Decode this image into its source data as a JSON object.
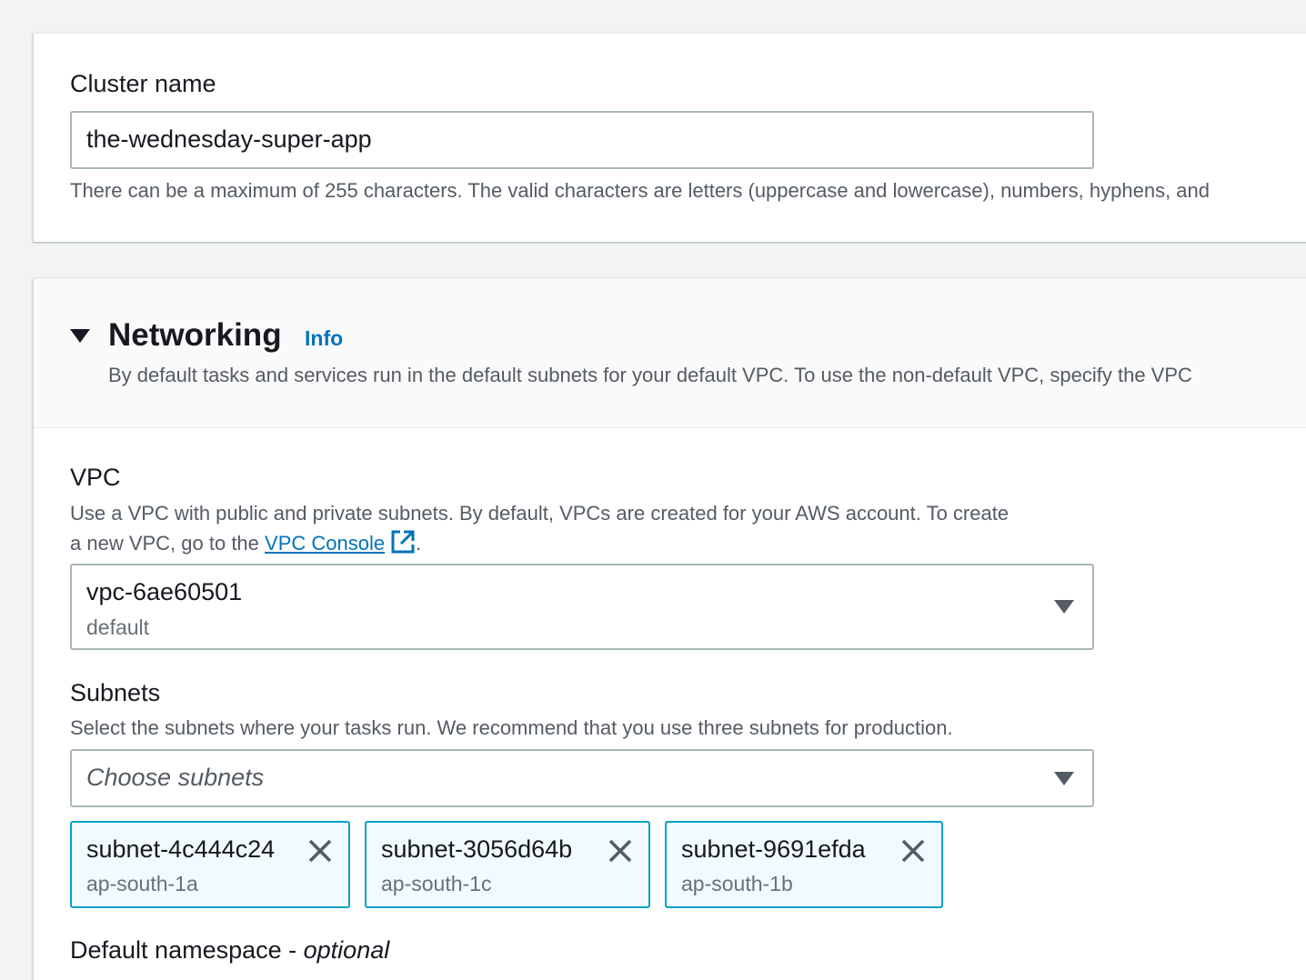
{
  "cluster": {
    "label": "Cluster name",
    "value": "the-wednesday-super-app",
    "hint": "There can be a maximum of 255 characters. The valid characters are letters (uppercase and lowercase), numbers, hyphens, and"
  },
  "networking": {
    "title": "Networking",
    "info_label": "Info",
    "description": "By default tasks and services run in the default subnets for your default VPC. To use the non-default VPC, specify the VPC",
    "vpc": {
      "label": "VPC",
      "desc_line1": "Use a VPC with public and private subnets. By default, VPCs are created for your AWS account. To create",
      "desc_line2_prefix": "a new VPC, go to the ",
      "console_link": "VPC Console",
      "desc_line2_suffix": ".",
      "selected_value": "vpc-6ae60501",
      "selected_sub": "default"
    },
    "subnets": {
      "label": "Subnets",
      "description": "Select the subnets where your tasks run. We recommend that you use three subnets for production.",
      "placeholder": "Choose subnets",
      "tokens": [
        {
          "name": "subnet-4c444c24",
          "az": "ap-south-1a"
        },
        {
          "name": "subnet-3056d64b",
          "az": "ap-south-1c"
        },
        {
          "name": "subnet-9691efda",
          "az": "ap-south-1b"
        }
      ]
    },
    "namespace": {
      "label": "Default namespace - ",
      "optional": "optional"
    }
  },
  "colors": {
    "link": "#0073bb",
    "token_border": "#00a1c9",
    "token_bg": "#f1faff"
  }
}
